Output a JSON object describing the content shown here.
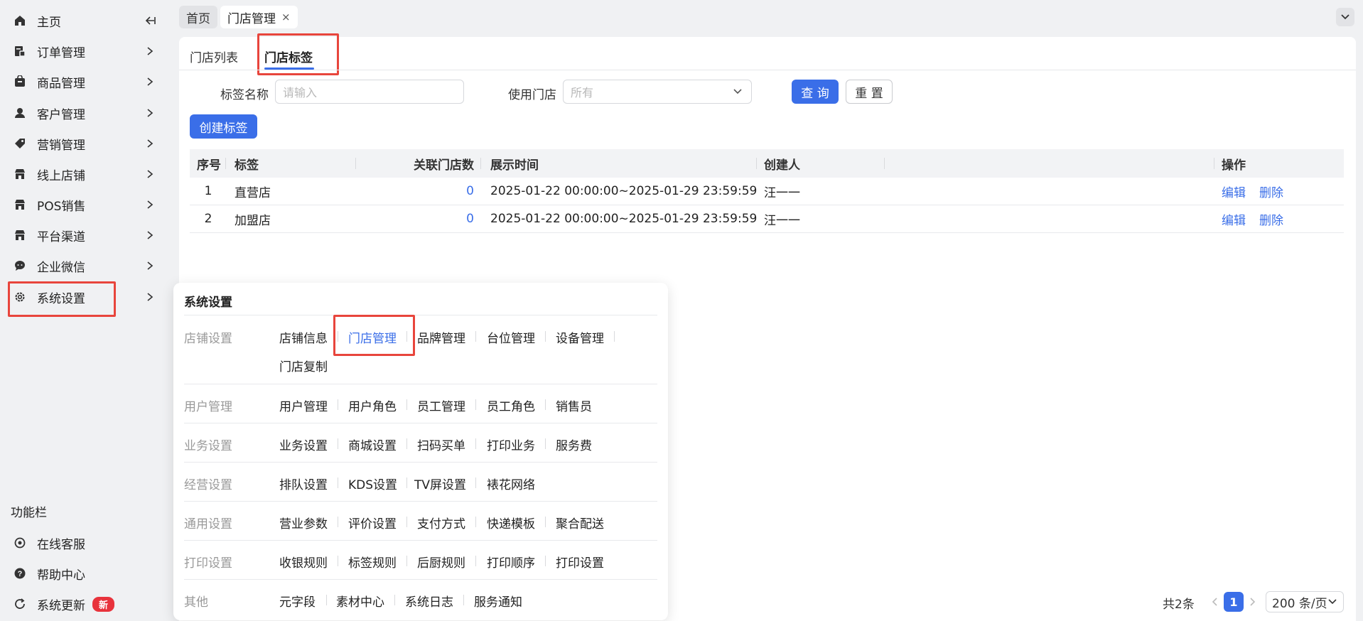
{
  "sidebar": {
    "items": [
      {
        "label": "主页",
        "icon": "home-icon"
      },
      {
        "label": "订单管理",
        "icon": "order-icon"
      },
      {
        "label": "商品管理",
        "icon": "product-icon"
      },
      {
        "label": "客户管理",
        "icon": "customer-icon"
      },
      {
        "label": "营销管理",
        "icon": "tag-icon"
      },
      {
        "label": "线上店铺",
        "icon": "store-icon"
      },
      {
        "label": "POS销售",
        "icon": "pos-icon"
      },
      {
        "label": "平台渠道",
        "icon": "platform-icon"
      },
      {
        "label": "企业微信",
        "icon": "wechat-icon"
      },
      {
        "label": "系统设置",
        "icon": "gear-icon"
      }
    ],
    "function_bar_title": "功能栏",
    "function_items": [
      {
        "label": "在线客服",
        "icon": "service-icon"
      },
      {
        "label": "帮助中心",
        "icon": "help-icon"
      },
      {
        "label": "系统更新",
        "icon": "refresh-icon",
        "badge": "新"
      }
    ]
  },
  "top_tabs": [
    {
      "label": "首页"
    },
    {
      "label": "门店管理",
      "close": "×"
    }
  ],
  "sub_tabs": [
    {
      "label": "门店列表"
    },
    {
      "label": "门店标签"
    }
  ],
  "filters": {
    "tag_name_label": "标签名称",
    "tag_name_placeholder": "请输入",
    "store_label": "使用门店",
    "store_value": "所有",
    "query_button": "查 询",
    "reset_button": "重 置"
  },
  "create_button": "创建标签",
  "table": {
    "headers": [
      "序号",
      "标签",
      "关联门店数",
      "展示时间",
      "创建人",
      "操作"
    ],
    "rows": [
      {
        "no": "1",
        "tag": "直营店",
        "count": "0",
        "time": "2025-01-22 00:00:00~2025-01-29 23:59:59",
        "creator": "汪一一",
        "edit": "编辑",
        "delete": "删除"
      },
      {
        "no": "2",
        "tag": "加盟店",
        "count": "0",
        "time": "2025-01-22 00:00:00~2025-01-29 23:59:59",
        "creator": "汪一一",
        "edit": "编辑",
        "delete": "删除"
      }
    ]
  },
  "pagination": {
    "total": "共2条",
    "current_page": "1",
    "page_size": "200 条/页"
  },
  "menu": {
    "title": "系统设置",
    "sections": [
      {
        "category": "店铺设置",
        "items": [
          "店铺信息",
          "门店管理",
          "品牌管理",
          "台位管理",
          "设备管理",
          "门店复制"
        ]
      },
      {
        "category": "用户管理",
        "items": [
          "用户管理",
          "用户角色",
          "员工管理",
          "员工角色",
          "销售员"
        ]
      },
      {
        "category": "业务设置",
        "items": [
          "业务设置",
          "商城设置",
          "扫码买单",
          "打印业务",
          "服务费"
        ]
      },
      {
        "category": "经营设置",
        "items": [
          "排队设置",
          "KDS设置",
          "TV屏设置",
          "裱花网络"
        ]
      },
      {
        "category": "通用设置",
        "items": [
          "营业参数",
          "评价设置",
          "支付方式",
          "快递模板",
          "聚合配送"
        ]
      },
      {
        "category": "打印设置",
        "items": [
          "收银规则",
          "标签规则",
          "后厨规则",
          "打印顺序",
          "打印设置"
        ]
      },
      {
        "category": "其他",
        "items": [
          "元字段",
          "素材中心",
          "系统日志",
          "服务通知"
        ]
      }
    ],
    "selected": "门店管理"
  },
  "colors": {
    "accent": "#3a6ee8",
    "highlight_box": "#e8453c",
    "badge": "#e8333c"
  }
}
